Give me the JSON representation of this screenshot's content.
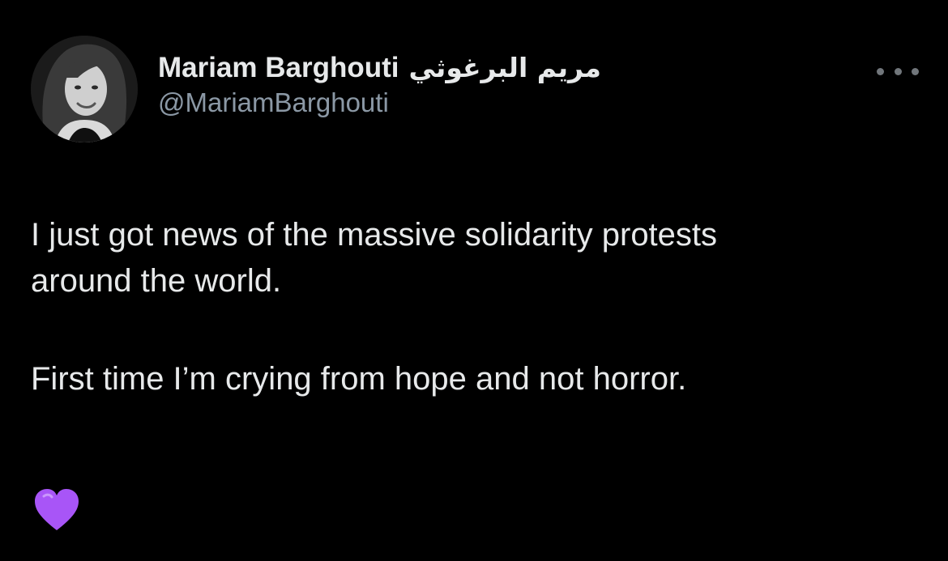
{
  "tweet": {
    "author": {
      "display_name": "Mariam Barghouti",
      "display_name_arabic": "مريم البرغوثي",
      "handle": "@MariamBarghouti",
      "avatar": "profile-photo"
    },
    "more_menu_icon": "more-horizontal-icon",
    "text_lines": [
      "I just got news of the massive solidarity protests",
      "around the world."
    ],
    "text_second_paragraph": "First time I’m crying from hope and not horror.",
    "emoji": "purple-heart",
    "emoji_color": "#a855f7"
  },
  "colors": {
    "background": "#000000",
    "primary_text": "#e7e9ea",
    "secondary_text": "#8b98a5"
  }
}
